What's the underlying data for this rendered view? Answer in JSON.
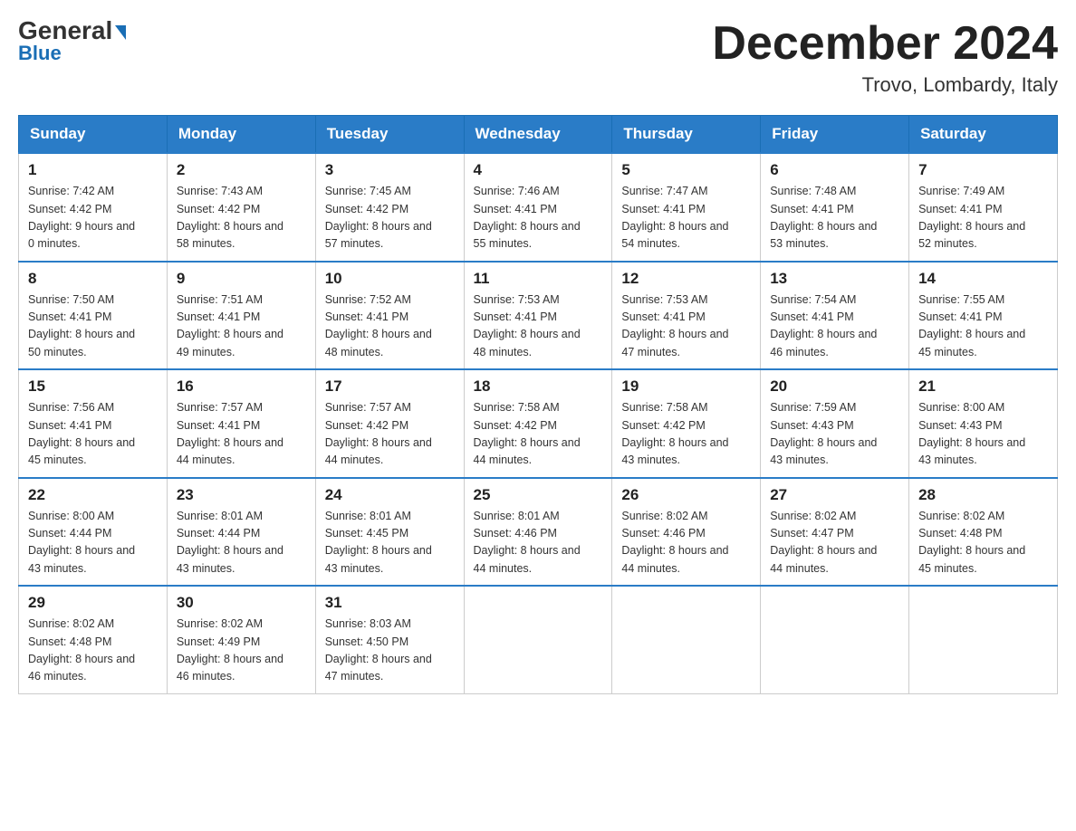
{
  "header": {
    "logo_line1": "General",
    "logo_line2": "Blue",
    "month_title": "December 2024",
    "location": "Trovo, Lombardy, Italy"
  },
  "days_of_week": [
    "Sunday",
    "Monday",
    "Tuesday",
    "Wednesday",
    "Thursday",
    "Friday",
    "Saturday"
  ],
  "weeks": [
    [
      {
        "day": 1,
        "sunrise": "7:42 AM",
        "sunset": "4:42 PM",
        "daylight": "9 hours and 0 minutes."
      },
      {
        "day": 2,
        "sunrise": "7:43 AM",
        "sunset": "4:42 PM",
        "daylight": "8 hours and 58 minutes."
      },
      {
        "day": 3,
        "sunrise": "7:45 AM",
        "sunset": "4:42 PM",
        "daylight": "8 hours and 57 minutes."
      },
      {
        "day": 4,
        "sunrise": "7:46 AM",
        "sunset": "4:41 PM",
        "daylight": "8 hours and 55 minutes."
      },
      {
        "day": 5,
        "sunrise": "7:47 AM",
        "sunset": "4:41 PM",
        "daylight": "8 hours and 54 minutes."
      },
      {
        "day": 6,
        "sunrise": "7:48 AM",
        "sunset": "4:41 PM",
        "daylight": "8 hours and 53 minutes."
      },
      {
        "day": 7,
        "sunrise": "7:49 AM",
        "sunset": "4:41 PM",
        "daylight": "8 hours and 52 minutes."
      }
    ],
    [
      {
        "day": 8,
        "sunrise": "7:50 AM",
        "sunset": "4:41 PM",
        "daylight": "8 hours and 50 minutes."
      },
      {
        "day": 9,
        "sunrise": "7:51 AM",
        "sunset": "4:41 PM",
        "daylight": "8 hours and 49 minutes."
      },
      {
        "day": 10,
        "sunrise": "7:52 AM",
        "sunset": "4:41 PM",
        "daylight": "8 hours and 48 minutes."
      },
      {
        "day": 11,
        "sunrise": "7:53 AM",
        "sunset": "4:41 PM",
        "daylight": "8 hours and 48 minutes."
      },
      {
        "day": 12,
        "sunrise": "7:53 AM",
        "sunset": "4:41 PM",
        "daylight": "8 hours and 47 minutes."
      },
      {
        "day": 13,
        "sunrise": "7:54 AM",
        "sunset": "4:41 PM",
        "daylight": "8 hours and 46 minutes."
      },
      {
        "day": 14,
        "sunrise": "7:55 AM",
        "sunset": "4:41 PM",
        "daylight": "8 hours and 45 minutes."
      }
    ],
    [
      {
        "day": 15,
        "sunrise": "7:56 AM",
        "sunset": "4:41 PM",
        "daylight": "8 hours and 45 minutes."
      },
      {
        "day": 16,
        "sunrise": "7:57 AM",
        "sunset": "4:41 PM",
        "daylight": "8 hours and 44 minutes."
      },
      {
        "day": 17,
        "sunrise": "7:57 AM",
        "sunset": "4:42 PM",
        "daylight": "8 hours and 44 minutes."
      },
      {
        "day": 18,
        "sunrise": "7:58 AM",
        "sunset": "4:42 PM",
        "daylight": "8 hours and 44 minutes."
      },
      {
        "day": 19,
        "sunrise": "7:58 AM",
        "sunset": "4:42 PM",
        "daylight": "8 hours and 43 minutes."
      },
      {
        "day": 20,
        "sunrise": "7:59 AM",
        "sunset": "4:43 PM",
        "daylight": "8 hours and 43 minutes."
      },
      {
        "day": 21,
        "sunrise": "8:00 AM",
        "sunset": "4:43 PM",
        "daylight": "8 hours and 43 minutes."
      }
    ],
    [
      {
        "day": 22,
        "sunrise": "8:00 AM",
        "sunset": "4:44 PM",
        "daylight": "8 hours and 43 minutes."
      },
      {
        "day": 23,
        "sunrise": "8:01 AM",
        "sunset": "4:44 PM",
        "daylight": "8 hours and 43 minutes."
      },
      {
        "day": 24,
        "sunrise": "8:01 AM",
        "sunset": "4:45 PM",
        "daylight": "8 hours and 43 minutes."
      },
      {
        "day": 25,
        "sunrise": "8:01 AM",
        "sunset": "4:46 PM",
        "daylight": "8 hours and 44 minutes."
      },
      {
        "day": 26,
        "sunrise": "8:02 AM",
        "sunset": "4:46 PM",
        "daylight": "8 hours and 44 minutes."
      },
      {
        "day": 27,
        "sunrise": "8:02 AM",
        "sunset": "4:47 PM",
        "daylight": "8 hours and 44 minutes."
      },
      {
        "day": 28,
        "sunrise": "8:02 AM",
        "sunset": "4:48 PM",
        "daylight": "8 hours and 45 minutes."
      }
    ],
    [
      {
        "day": 29,
        "sunrise": "8:02 AM",
        "sunset": "4:48 PM",
        "daylight": "8 hours and 46 minutes."
      },
      {
        "day": 30,
        "sunrise": "8:02 AM",
        "sunset": "4:49 PM",
        "daylight": "8 hours and 46 minutes."
      },
      {
        "day": 31,
        "sunrise": "8:03 AM",
        "sunset": "4:50 PM",
        "daylight": "8 hours and 47 minutes."
      },
      null,
      null,
      null,
      null
    ]
  ]
}
